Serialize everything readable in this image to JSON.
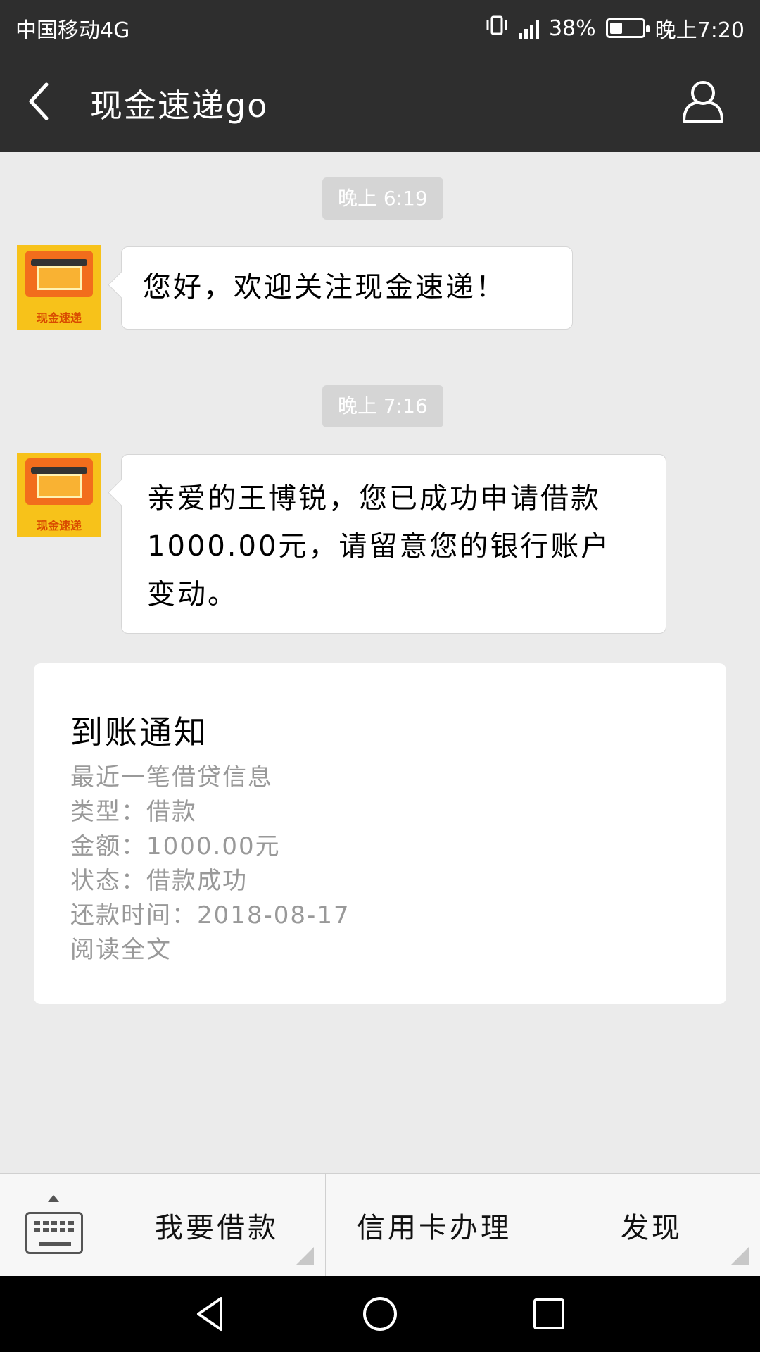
{
  "status_bar": {
    "carrier": "中国移动4G",
    "network": "4G",
    "battery_percent_text": "38%",
    "battery_level": 0.38,
    "time": "晚上7:20"
  },
  "header": {
    "title": "现金速递go",
    "back_icon": "back-arrow-icon",
    "profile_icon": "user-profile-icon"
  },
  "chat": {
    "messages": [
      {
        "timestamp": "晚上 6:19",
        "avatar_label": "现金速递",
        "text": "您好，欢迎关注现金速递！"
      },
      {
        "timestamp": "晚上 7:16",
        "avatar_label": "现金速递",
        "text": "亲爱的王博锐，您已成功申请借款1000.00元，请留意您的银行账户变动。"
      }
    ],
    "card": {
      "title": "到账通知",
      "lines": [
        "最近一笔借贷信息",
        "类型：借款",
        "金额：1000.00元",
        "状态：借款成功",
        "还款时间：2018-08-17",
        "阅读全文"
      ]
    }
  },
  "menu": {
    "keyboard_icon": "keyboard-icon",
    "items": [
      "我要借款",
      "信用卡办理",
      "发现"
    ]
  },
  "nav": {
    "back_icon": "nav-back-icon",
    "home_icon": "nav-home-icon",
    "recents_icon": "nav-recents-icon"
  },
  "colors": {
    "header_bg": "#2e2e2e",
    "chat_bg": "#ebebeb",
    "avatar_bg": "#f7c21a",
    "avatar_accent": "#f26d1c"
  }
}
